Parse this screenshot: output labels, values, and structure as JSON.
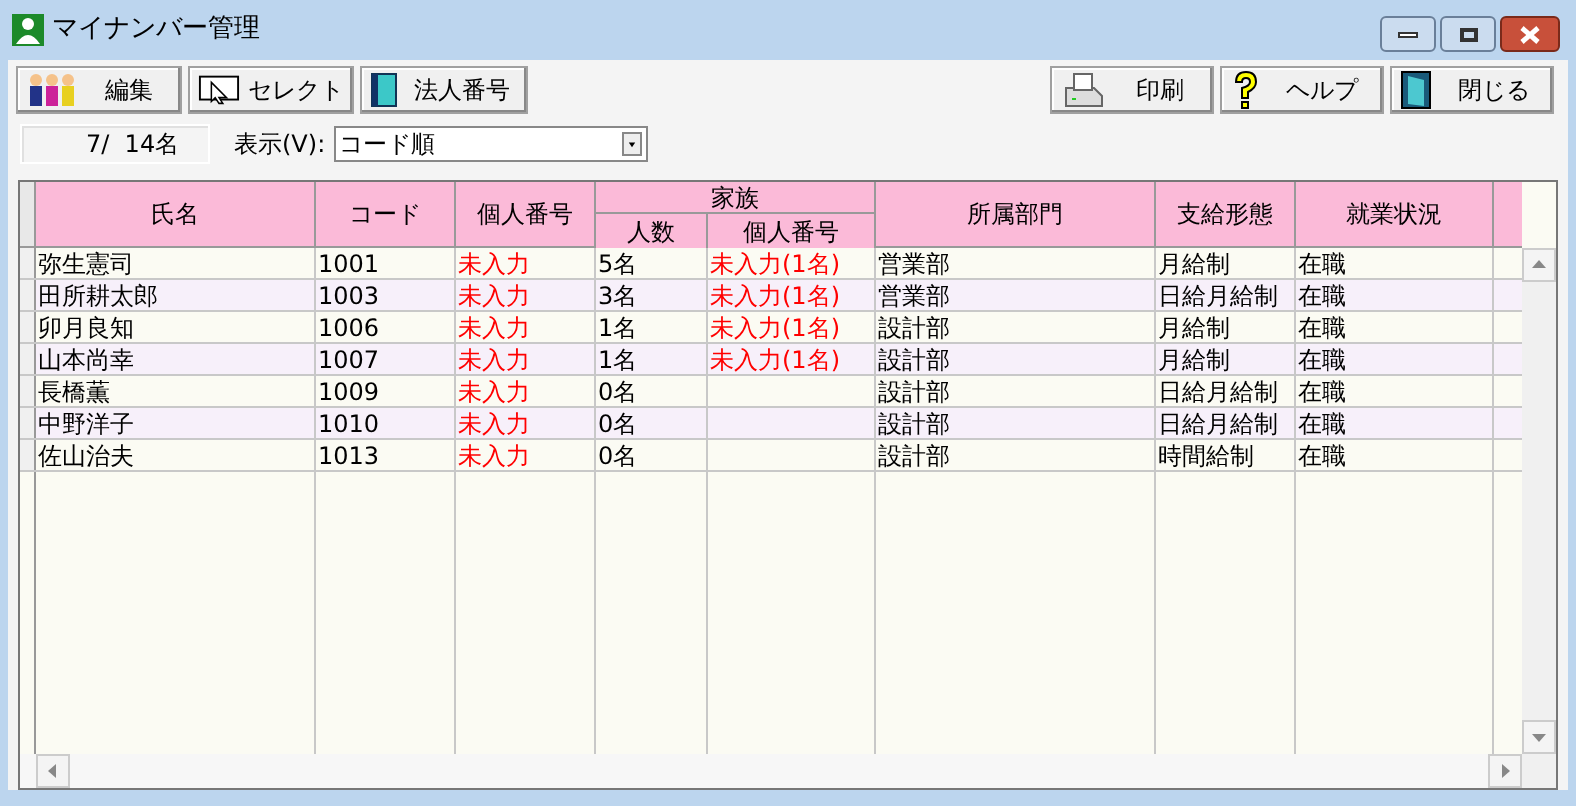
{
  "window": {
    "title": "マイナンバー管理"
  },
  "toolbar_left": [
    "編集",
    "セレクト",
    "法人番号"
  ],
  "toolbar_right": [
    "印刷",
    "ヘルプ",
    "閉じる"
  ],
  "count": "7/  14名",
  "view": {
    "label": "表示(V):",
    "value": "コード順"
  },
  "table": {
    "columns": [
      "氏名",
      "コード",
      "個人番号",
      "所属部門",
      "支給形態",
      "就業状況"
    ],
    "group": {
      "label": "家族",
      "columns": [
        "人数",
        "個人番号"
      ]
    },
    "rows": [
      {
        "name": "弥生憲司",
        "code": "1001",
        "my_number": "未入力",
        "family_count": "5名",
        "family_number": "未入力(1名)",
        "dept": "営業部",
        "pay": "月給制",
        "status": "在職"
      },
      {
        "name": "田所耕太郎",
        "code": "1003",
        "my_number": "未入力",
        "family_count": "3名",
        "family_number": "未入力(1名)",
        "dept": "営業部",
        "pay": "日給月給制",
        "status": "在職"
      },
      {
        "name": "卯月良知",
        "code": "1006",
        "my_number": "未入力",
        "family_count": "1名",
        "family_number": "未入力(1名)",
        "dept": "設計部",
        "pay": "月給制",
        "status": "在職"
      },
      {
        "name": "山本尚幸",
        "code": "1007",
        "my_number": "未入力",
        "family_count": "1名",
        "family_number": "未入力(1名)",
        "dept": "設計部",
        "pay": "月給制",
        "status": "在職"
      },
      {
        "name": "長橋薫",
        "code": "1009",
        "my_number": "未入力",
        "family_count": "0名",
        "dept": "設計部",
        "pay": "日給月給制",
        "status": "在職"
      },
      {
        "name": "中野洋子",
        "code": "1010",
        "my_number": "未入力",
        "family_count": "0名",
        "dept": "設計部",
        "pay": "日給月給制",
        "status": "在職"
      },
      {
        "name": "佐山治夫",
        "code": "1013",
        "my_number": "未入力",
        "family_count": "0名",
        "dept": "設計部",
        "pay": "時間給制",
        "status": "在職"
      }
    ]
  }
}
